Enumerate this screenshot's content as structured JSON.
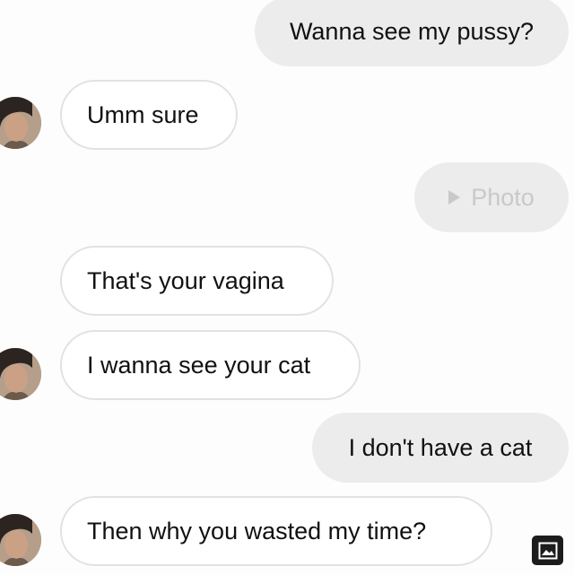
{
  "messages": [
    {
      "sender": "me",
      "text": "Wanna see my pussy?"
    },
    {
      "sender": "them",
      "text": "Umm sure"
    },
    {
      "sender": "me",
      "text": "Photo",
      "kind": "photo",
      "icon": "play-icon"
    },
    {
      "sender": "them",
      "text": "That's your vagina"
    },
    {
      "sender": "them",
      "text": "I wanna see your cat"
    },
    {
      "sender": "me",
      "text": "I don't have a cat"
    },
    {
      "sender": "them",
      "text": "Then why you wasted my time?"
    }
  ],
  "icons": {
    "avatar": "profile-photo",
    "gallery": "image-icon"
  },
  "colors": {
    "outgoing_bubble": "#ececec",
    "incoming_bubble": "#ffffff",
    "incoming_border": "#e2e2e2",
    "photo_text": "#c9c9c9"
  }
}
